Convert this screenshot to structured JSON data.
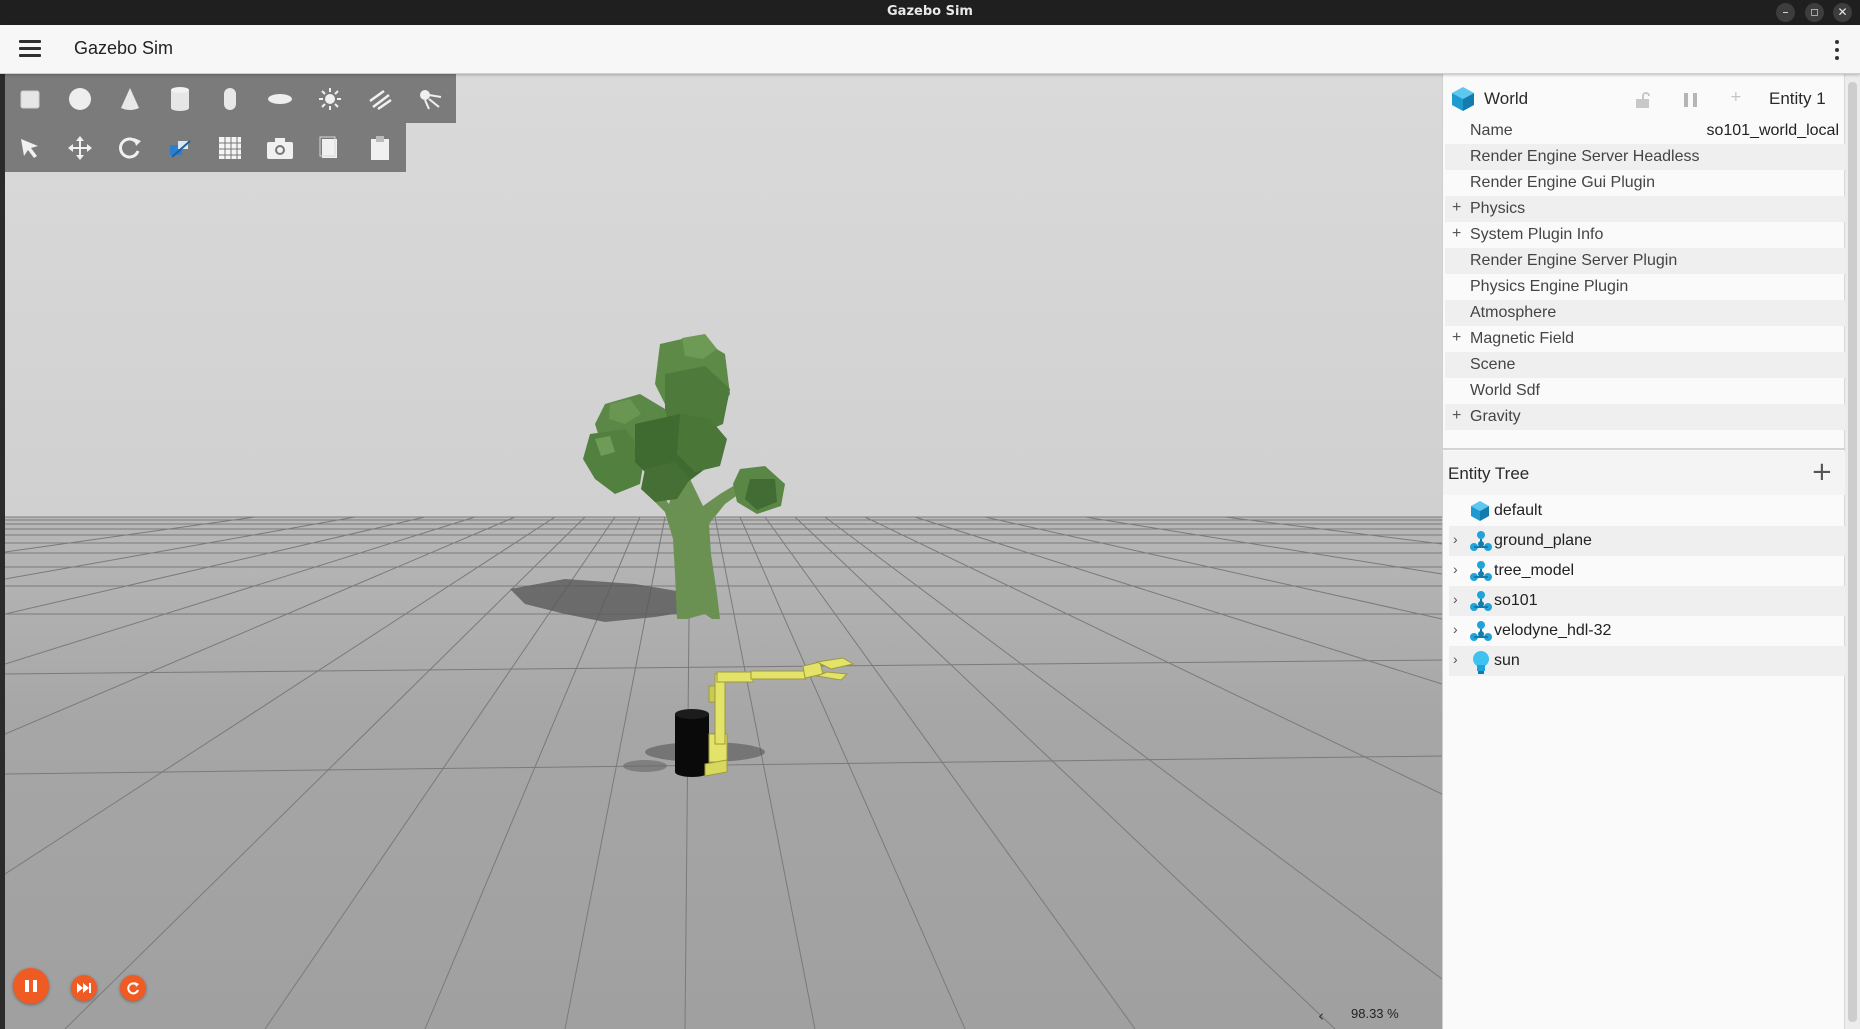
{
  "window": {
    "title": "Gazebo Sim",
    "controls": [
      "minimize-icon",
      "maximize-icon",
      "close-icon"
    ]
  },
  "app": {
    "title": "Gazebo Sim"
  },
  "toolbar_shapes": {
    "icons": [
      "box-icon",
      "sphere-icon",
      "cone-icon",
      "cylinder-icon",
      "capsule-icon",
      "ellipsoid-icon",
      "point-light-icon",
      "directional-light-icon",
      "spot-light-icon"
    ]
  },
  "toolbar_tools": {
    "icons": [
      "select-icon",
      "translate-icon",
      "rotate-icon",
      "transform-control-icon",
      "grid-snap-icon",
      "screenshot-icon",
      "copy-icon",
      "paste-icon"
    ]
  },
  "sim_controls": {
    "icons": [
      "pause-icon",
      "step-icon",
      "reset-icon"
    ],
    "real_time_factor": "98.33 %"
  },
  "component_inspector": {
    "header": {
      "title": "World",
      "entity": "Entity 1"
    },
    "rows": [
      {
        "label": "Name",
        "value": "so101_world_local",
        "expandable": false
      },
      {
        "label": "Render Engine Server Headless",
        "expandable": false
      },
      {
        "label": "Render Engine Gui Plugin",
        "expandable": false
      },
      {
        "label": "Physics",
        "expandable": true
      },
      {
        "label": "System Plugin Info",
        "expandable": true
      },
      {
        "label": "Render Engine Server Plugin",
        "expandable": false
      },
      {
        "label": "Physics Engine Plugin",
        "expandable": false
      },
      {
        "label": "Atmosphere",
        "expandable": false
      },
      {
        "label": "Magnetic Field",
        "expandable": true
      },
      {
        "label": "Scene",
        "expandable": false
      },
      {
        "label": "World Sdf",
        "expandable": false
      },
      {
        "label": "Gravity",
        "expandable": true
      }
    ]
  },
  "entity_tree": {
    "title": "Entity Tree",
    "items": [
      {
        "label": "default",
        "icon": "world-cube-icon",
        "expandable": false
      },
      {
        "label": "ground_plane",
        "icon": "model-icon",
        "expandable": true
      },
      {
        "label": "tree_model",
        "icon": "model-icon",
        "expandable": true
      },
      {
        "label": "so101",
        "icon": "model-icon",
        "expandable": true
      },
      {
        "label": "velodyne_hdl-32",
        "icon": "model-icon",
        "expandable": true
      },
      {
        "label": "sun",
        "icon": "light-bulb-icon",
        "expandable": true
      }
    ]
  },
  "colors": {
    "accent": "#f05a23",
    "entity_icon": "#1fa3d8",
    "sky": "#d8d8d8",
    "ground": "#a3a3a3",
    "tree_foliage": "#5e8a48",
    "robot_arm": "#e3e36a"
  }
}
